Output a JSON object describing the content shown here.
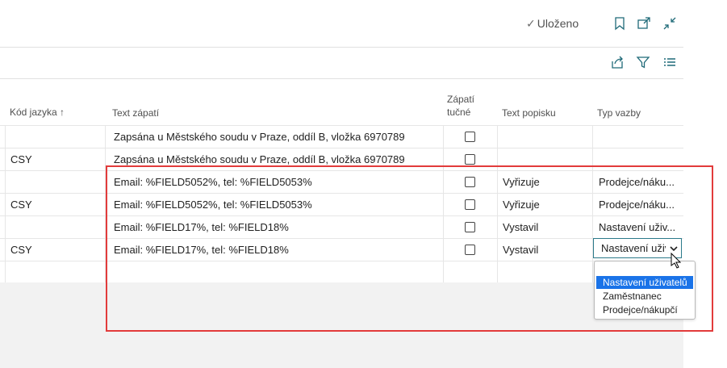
{
  "top": {
    "saved_label": "Uloženo"
  },
  "table": {
    "headers": {
      "lang": "Kód jazyka",
      "text": "Text zápatí",
      "bold_line1": "Zápatí",
      "bold_line2": "tučné",
      "popis": "Text popisku",
      "typ": "Typ vazby"
    },
    "sort_indicator": "↑",
    "rows": [
      {
        "lang": "",
        "text": "Zapsána u Městského soudu v Praze, oddíl B, vložka 6970789",
        "bold": false,
        "popis": "",
        "typ": ""
      },
      {
        "lang": "CSY",
        "text": "Zapsána u Městského soudu v Praze, oddíl B, vložka 6970789",
        "bold": false,
        "popis": "",
        "typ": ""
      },
      {
        "lang": "",
        "text": "Email: %FIELD5052%,  tel: %FIELD5053%",
        "bold": false,
        "popis": "Vyřizuje",
        "typ": "Prodejce/náku..."
      },
      {
        "lang": "CSY",
        "text": "Email: %FIELD5052%,  tel: %FIELD5053%",
        "bold": false,
        "popis": "Vyřizuje",
        "typ": "Prodejce/náku..."
      },
      {
        "lang": "",
        "text": "Email: %FIELD17%,   tel: %FIELD18%",
        "bold": false,
        "popis": "Vystavil",
        "typ": "Nastavení uživ..."
      },
      {
        "lang": "CSY",
        "text": "Email: %FIELD17%,   tel: %FIELD18%",
        "bold": false,
        "popis": "Vystavil",
        "typ": ""
      },
      {
        "lang": "",
        "text": "",
        "bold": false,
        "popis": "",
        "typ": ""
      }
    ]
  },
  "select": {
    "value": "Nastavení uživatelů",
    "options": [
      "Nastavení uživatelů",
      "Zaměstnanec",
      "Prodejce/nákupčí"
    ],
    "selected_index": 0
  },
  "colors": {
    "highlight": "#e23b3b",
    "accent": "#2b7a8a",
    "selected_option": "#1a73e8"
  },
  "icons": [
    "check-icon",
    "bookmark-icon",
    "open-in-new-window-icon",
    "collapse-icon",
    "share-icon",
    "filter-icon",
    "list-icon",
    "chevron-down-icon",
    "mouse-cursor-icon"
  ]
}
